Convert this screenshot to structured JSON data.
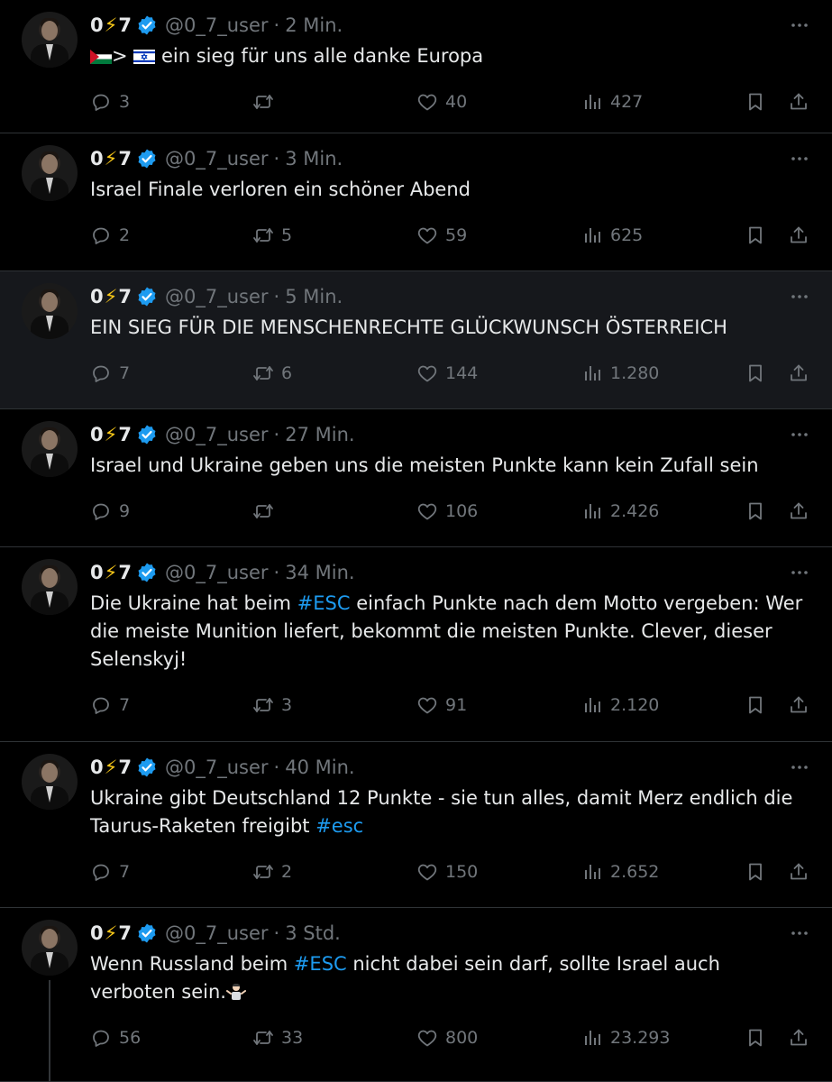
{
  "user": {
    "name_prefix": "0",
    "name_bolt": "⚡",
    "name_suffix": "7",
    "handle": "@0_7_user"
  },
  "tweets": [
    {
      "time": "2 Min.",
      "text_after_flags": "ein sieg für uns alle danke Europa",
      "flag_sep": ">",
      "replies": "3",
      "reposts": "",
      "likes": "40",
      "views": "427"
    },
    {
      "time": "3 Min.",
      "text": "Israel Finale verloren ein schöner Abend",
      "replies": "2",
      "reposts": "5",
      "likes": "59",
      "views": "625"
    },
    {
      "time": "5 Min.",
      "text": "EIN SIEG FÜR DIE MENSCHENRECHTE GLÜCKWUNSCH ÖSTERREICH",
      "replies": "7",
      "reposts": "6",
      "likes": "144",
      "views": "1.280"
    },
    {
      "time": "27 Min.",
      "text": "Israel und Ukraine geben uns die meisten Punkte kann kein Zufall sein",
      "replies": "9",
      "reposts": "",
      "likes": "106",
      "views": "2.426"
    },
    {
      "time": "34 Min.",
      "text_before": "Die Ukraine hat beim ",
      "hashtag": "#ESC",
      "text_after": " einfach Punkte nach dem Motto vergeben: Wer die meiste Munition liefert, bekommt die meisten Punkte. Clever, dieser Selenskyj!",
      "replies": "7",
      "reposts": "3",
      "likes": "91",
      "views": "2.120"
    },
    {
      "time": "40 Min.",
      "text_before": "Ukraine gibt Deutschland 12 Punkte - sie tun alles, damit Merz endlich die Taurus-Raketen freigibt ",
      "hashtag": "#esc",
      "replies": "7",
      "reposts": "2",
      "likes": "150",
      "views": "2.652"
    },
    {
      "time": "3 Std.",
      "text_before": "Wenn Russland beim ",
      "hashtag": "#ESC",
      "text_after": " nicht dabei sein darf, sollte Israel auch verboten sein.",
      "replies": "56",
      "reposts": "33",
      "likes": "800",
      "views": "23.293"
    }
  ],
  "icons": {
    "reply": "reply-icon",
    "repost": "repost-icon",
    "like": "like-icon",
    "views": "views-icon",
    "bookmark": "bookmark-icon",
    "share": "share-icon",
    "more": "more-icon",
    "verified": "verified-badge-icon"
  },
  "colors": {
    "background": "#000000",
    "highlight_row": "#16181c",
    "accent": "#1d9bf0",
    "muted": "#71767b",
    "text": "#e7e9ea"
  }
}
